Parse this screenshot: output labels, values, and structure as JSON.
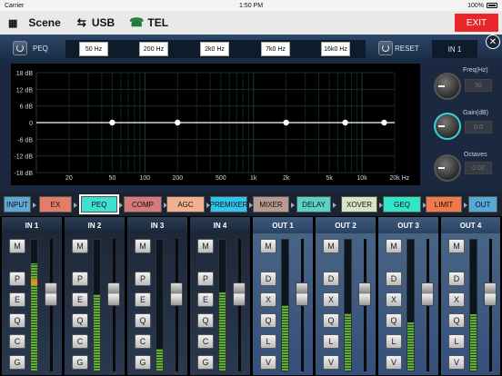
{
  "status_bar": {
    "carrier": "Carrier",
    "time": "1:50 PM",
    "battery": "100%"
  },
  "top_bar": {
    "scene": "Scene",
    "usb": "USB",
    "tel": "TEL",
    "exit": "EXIT"
  },
  "peq_bar": {
    "label": "PEQ",
    "freq_buttons": [
      "50 Hz",
      "200 Hz",
      "2k0 Hz",
      "7k0 Hz",
      "16k0 Hz"
    ],
    "reset": "RESET",
    "channel": "IN 1"
  },
  "eq_chart": {
    "y_labels": [
      "18 dB",
      "12 dB",
      "6 dB",
      "0",
      "-6 dB",
      "-12 dB",
      "-18 dB"
    ],
    "x_labels": [
      "20",
      "50",
      "100",
      "200",
      "500",
      "1k",
      "2k",
      "5k",
      "10k",
      "20k",
      "Hz"
    ]
  },
  "chart_data": {
    "type": "line",
    "x": [
      50,
      200,
      2000,
      7000,
      16000
    ],
    "y": [
      0,
      0,
      0,
      0,
      0
    ],
    "ylim": [
      -18,
      18
    ],
    "xscale": "log",
    "xlabel": "Hz"
  },
  "knobs": {
    "freq_label": "Freq(Hz)",
    "freq_value": "50",
    "gain_label": "Gain(dB)",
    "gain_value": "0.0",
    "oct_label": "Octaves",
    "oct_value": "0.02"
  },
  "tabs": [
    {
      "label": "INPUT",
      "color": "#5fa8d3"
    },
    {
      "label": "EX",
      "color": "#e57b6b"
    },
    {
      "label": "PEQ",
      "color": "#3ee0d0"
    },
    {
      "label": "COMP",
      "color": "#d47a78"
    },
    {
      "label": "AGC",
      "color": "#f2b090"
    },
    {
      "label": "PREMIXER",
      "color": "#2ec5ef"
    },
    {
      "label": "MIXER",
      "color": "#b89a90"
    },
    {
      "label": "DELAY",
      "color": "#5ad3c6"
    },
    {
      "label": "XOVER",
      "color": "#d9e4c3"
    },
    {
      "label": "GEQ",
      "color": "#33e5c8"
    },
    {
      "label": "LIMIT",
      "color": "#f07a4a"
    },
    {
      "label": "OUT",
      "color": "#55a9d7"
    }
  ],
  "inputs": [
    {
      "name": "IN 1",
      "buttons": [
        "M",
        "P",
        "E",
        "Q",
        "C",
        "G"
      ],
      "level": 0.82
    },
    {
      "name": "IN 2",
      "buttons": [
        "M",
        "P",
        "E",
        "Q",
        "C",
        "G"
      ],
      "level": 0.58
    },
    {
      "name": "IN 3",
      "buttons": [
        "M",
        "P",
        "E",
        "Q",
        "C",
        "G"
      ],
      "level": 0.17
    },
    {
      "name": "IN 4",
      "buttons": [
        "M",
        "P",
        "E",
        "Q",
        "C",
        "G"
      ],
      "level": 0.6
    }
  ],
  "outputs": [
    {
      "name": "OUT 1",
      "buttons": [
        "M",
        "D",
        "X",
        "Q",
        "L",
        "V"
      ],
      "level": 0.5
    },
    {
      "name": "OUT 2",
      "buttons": [
        "M",
        "D",
        "X",
        "Q",
        "L",
        "V"
      ],
      "level": 0.44
    },
    {
      "name": "OUT 3",
      "buttons": [
        "M",
        "D",
        "X",
        "Q",
        "L",
        "V"
      ],
      "level": 0.37
    },
    {
      "name": "OUT 4",
      "buttons": [
        "M",
        "D",
        "X",
        "Q",
        "L",
        "V"
      ],
      "level": 0.43
    }
  ]
}
